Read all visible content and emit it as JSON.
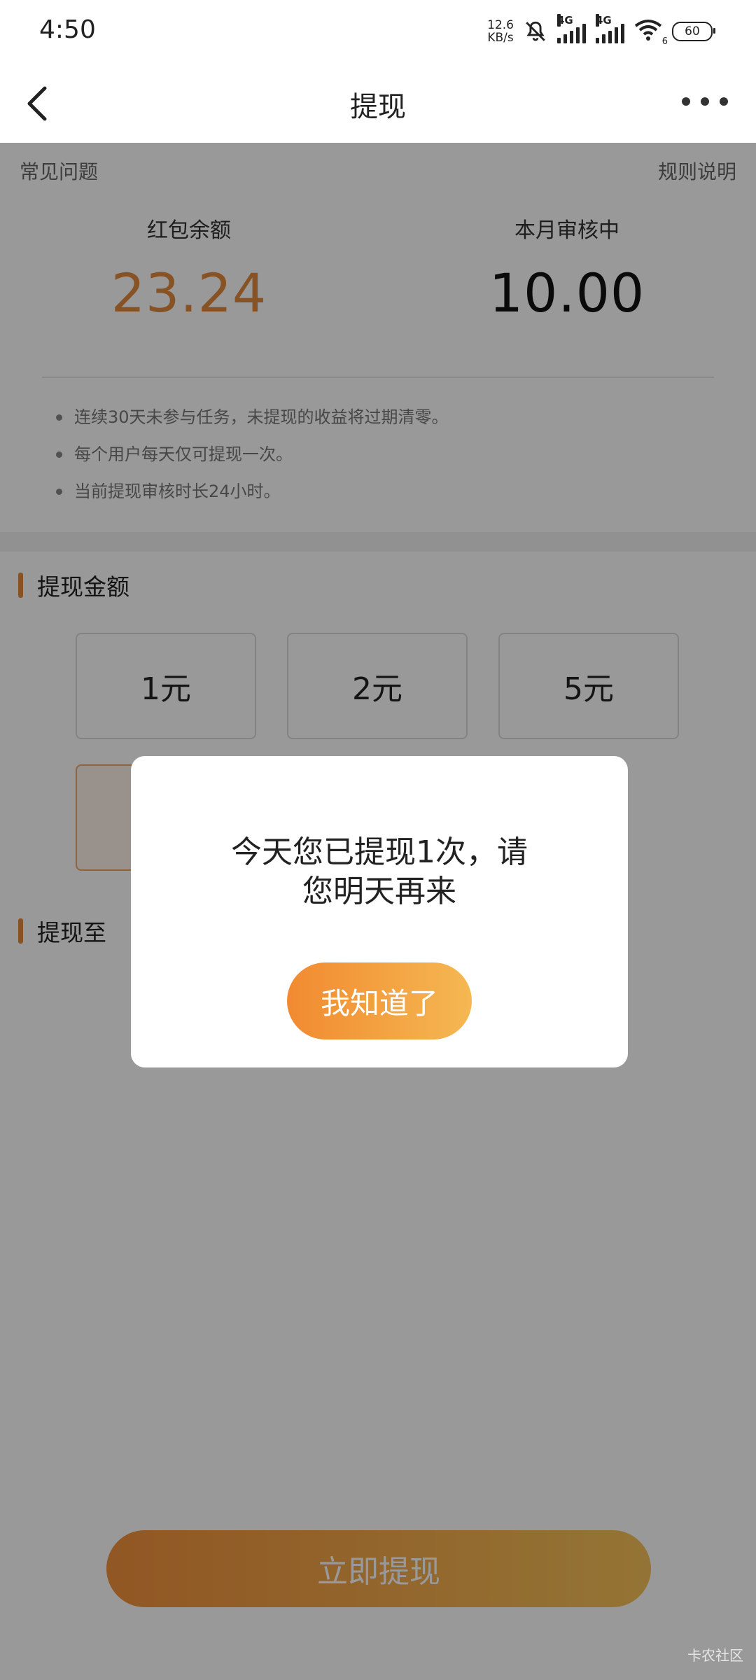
{
  "status_bar": {
    "time": "4:50",
    "net_speed_value": "12.6",
    "net_speed_unit": "KB/s",
    "network_1": "4G",
    "network_2": "4G",
    "wifi_level": "6",
    "battery": "60"
  },
  "header": {
    "title": "提现"
  },
  "links": {
    "faq": "常见问题",
    "rules": "规则说明"
  },
  "balance": {
    "left_label": "红包余额",
    "left_value": "23.24",
    "right_label": "本月审核中",
    "right_value": "10.00"
  },
  "tips": [
    "连续30天未参与任务，未提现的收益将过期清零。",
    "每个用户每天仅可提现一次。",
    "当前提现审核时长24小时。"
  ],
  "amount_section": {
    "title": "提现金额",
    "options": [
      "1元",
      "2元",
      "5元"
    ]
  },
  "target_section": {
    "title": "提现至"
  },
  "submit": {
    "label": "立即提现"
  },
  "dialog": {
    "message_line1": "今天您已提现1次，请",
    "message_line2": "您明天再来",
    "button": "我知道了"
  },
  "watermark": "卡农社区",
  "colors": {
    "accent": "#e38a3c",
    "overlay": "rgba(0,0,0,0.40)"
  }
}
